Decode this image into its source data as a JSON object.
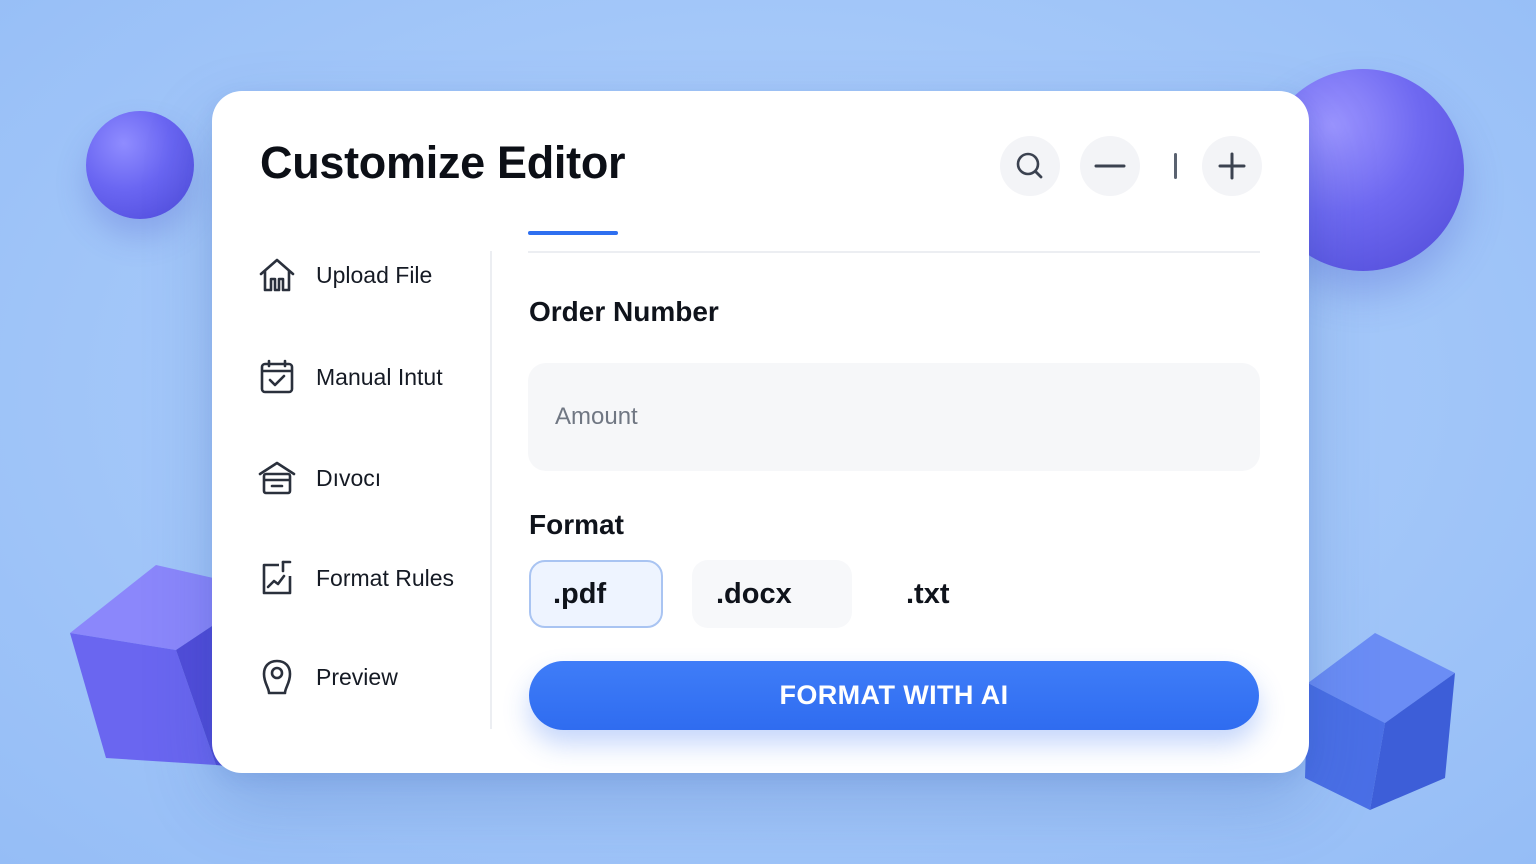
{
  "window": {
    "title": "Customize Editor"
  },
  "toolbar": {
    "search_icon": "search-icon",
    "minus_icon": "minus-icon",
    "plus_icon": "plus-icon"
  },
  "sidebar": {
    "items": [
      {
        "label": "Upload File",
        "icon": "home-icon"
      },
      {
        "label": "Manual Intut",
        "icon": "calendar-check-icon"
      },
      {
        "label": "Dıvocı",
        "icon": "archive-box-icon"
      },
      {
        "label": "Format Rules",
        "icon": "document-chart-icon"
      },
      {
        "label": "Preview",
        "icon": "location-pin-icon"
      }
    ]
  },
  "main": {
    "order_label": "Order Number",
    "amount_placeholder": "Amount",
    "format_label": "Format",
    "formats": [
      {
        "label": ".pdf",
        "selected": true
      },
      {
        "label": ".docx",
        "selected": false
      },
      {
        "label": ".txt",
        "selected": false
      }
    ],
    "cta_label": "FORMAT WITH AI"
  },
  "colors": {
    "accent": "#2e6ff0",
    "background": "#a3c7f9",
    "decor_purple": "#6a66f2"
  }
}
